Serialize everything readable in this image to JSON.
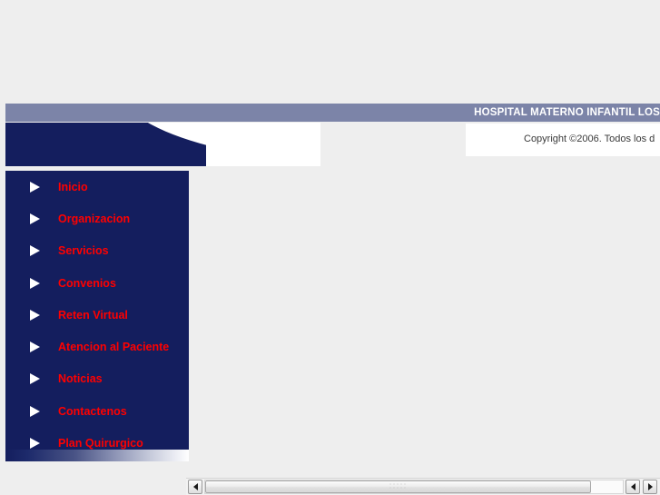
{
  "header": {
    "site_title": "HOSPITAL MATERNO INFANTIL LOS",
    "bar_color": "#7c84a8"
  },
  "banner": {
    "background_color": "#141e5e"
  },
  "copyright": {
    "text": "Copyright ©2006. Todos los d"
  },
  "sidebar": {
    "background_color": "#141e5e",
    "label_color": "#ff0000",
    "items": [
      {
        "label": "Inicio",
        "icon": "triangle-right-icon"
      },
      {
        "label": "Organizacion",
        "icon": "triangle-right-icon"
      },
      {
        "label": "Servicios",
        "icon": "triangle-right-icon"
      },
      {
        "label": "Convenios",
        "icon": "triangle-right-icon"
      },
      {
        "label": "Reten Virtual",
        "icon": "triangle-right-icon"
      },
      {
        "label": "Atencion al Paciente",
        "icon": "triangle-right-icon"
      },
      {
        "label": "Noticias",
        "icon": "triangle-right-icon"
      },
      {
        "label": "Contactenos",
        "icon": "triangle-right-icon"
      },
      {
        "label": "Plan Quirurgico",
        "icon": "triangle-right-icon"
      }
    ]
  },
  "scrollbar": {
    "left_arrow_icon": "arrow-left-icon",
    "right_arrow_icon_1": "arrow-left-icon",
    "right_arrow_icon_2": "arrow-right-icon"
  }
}
